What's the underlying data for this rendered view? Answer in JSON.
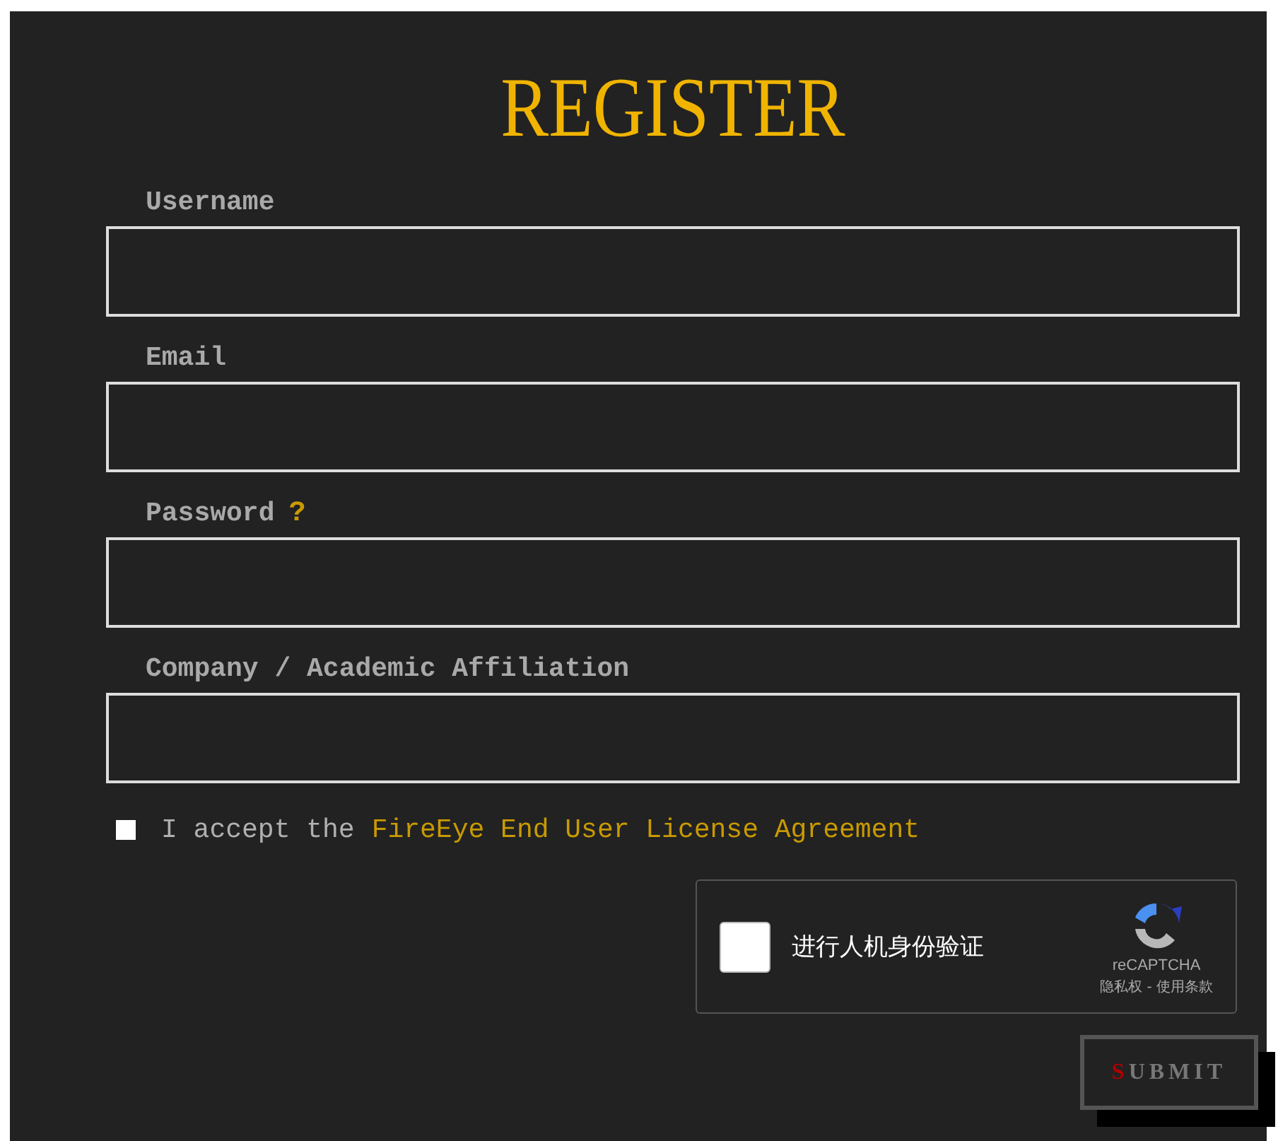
{
  "title": "REGISTER",
  "fields": [
    {
      "label": "Username"
    },
    {
      "label": "Email"
    },
    {
      "label": "Password",
      "help": "?"
    },
    {
      "label": "Company / Academic Affiliation"
    }
  ],
  "agreement": {
    "checked": false,
    "text": "I accept the",
    "link": "FireEye End User License Agreement"
  },
  "captcha": {
    "checked": false,
    "label": "进行人机身份验证",
    "brand": "reCAPTCHA",
    "links": "隐私权 - 使用条款"
  },
  "submit": "SUBMIT"
}
